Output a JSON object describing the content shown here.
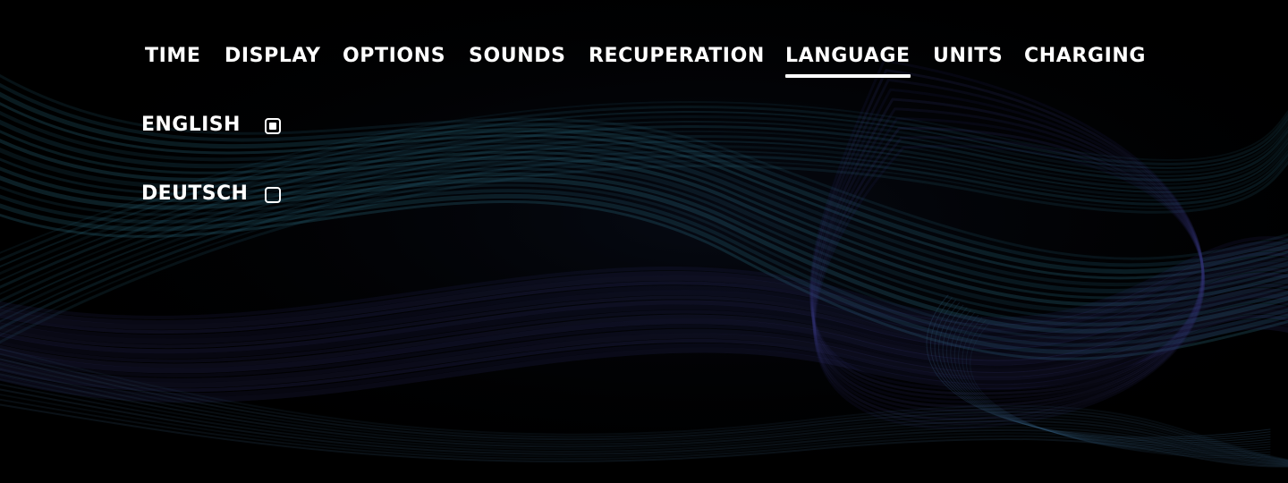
{
  "tabs": [
    {
      "label": "TIME",
      "active": false
    },
    {
      "label": "DISPLAY",
      "active": false
    },
    {
      "label": "OPTIONS",
      "active": false
    },
    {
      "label": "SOUNDS",
      "active": false
    },
    {
      "label": "RECUPERATION",
      "active": false
    },
    {
      "label": "LANGUAGE",
      "active": true
    },
    {
      "label": "UNITS",
      "active": false
    },
    {
      "label": "CHARGING",
      "active": false
    }
  ],
  "languages": [
    {
      "label": "ENGLISH",
      "selected": true
    },
    {
      "label": "DEUTSCH",
      "selected": false
    }
  ],
  "colors": {
    "background": "#000000",
    "text": "#ffffff",
    "wave_teal": "#2a6f86",
    "wave_indigo": "#3a3a8a"
  }
}
